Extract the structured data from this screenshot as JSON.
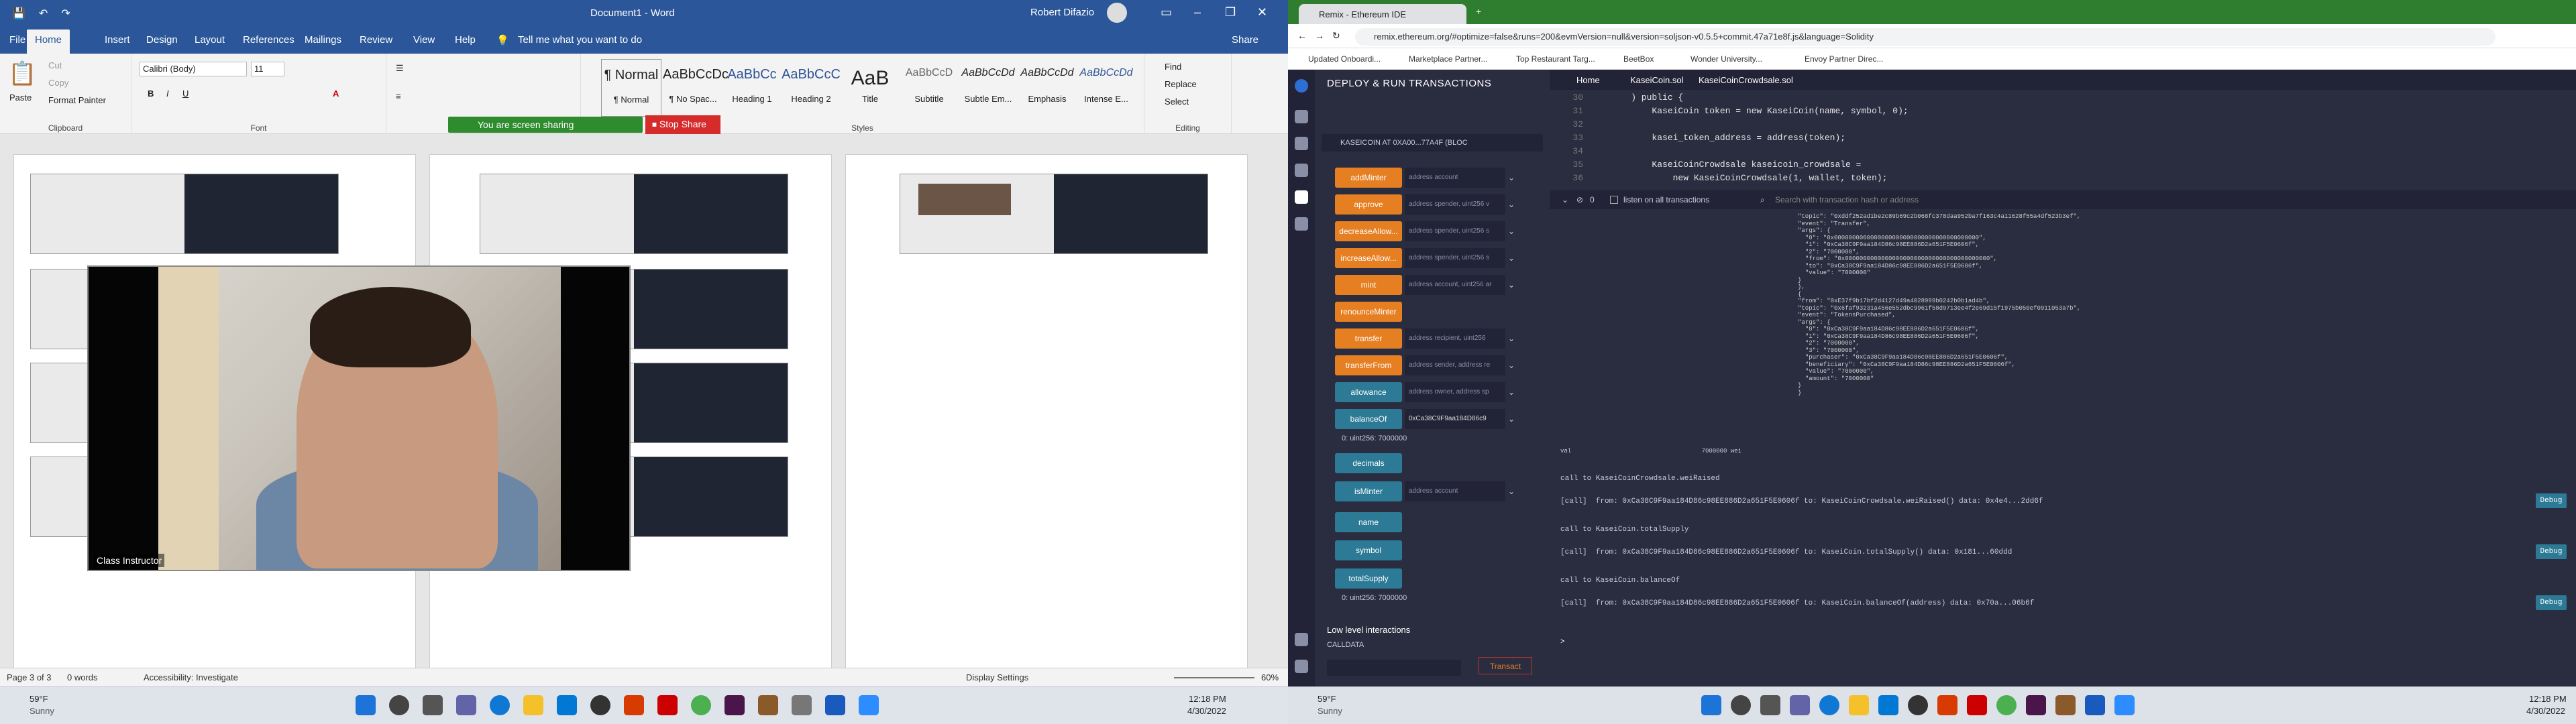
{
  "word": {
    "title": "Document1  -  Word",
    "user": "Robert Difazio",
    "share": "Share",
    "tabs": [
      "File",
      "Home",
      "Insert",
      "Design",
      "Layout",
      "References",
      "Mailings",
      "Review",
      "View",
      "Help"
    ],
    "tell_me": "Tell me what you want to do",
    "clipboard": {
      "paste": "Paste",
      "cut": "Cut",
      "copy": "Copy",
      "format_painter": "Format Painter",
      "label": "Clipboard"
    },
    "font": {
      "name": "Calibri (Body)",
      "size": "11",
      "label": "Font"
    },
    "paragraph_label": "Paragraph",
    "styles": [
      {
        "preview": "¶ Normal",
        "name": "¶ Normal"
      },
      {
        "preview": "AaBbCcDc",
        "name": "¶ No Spac..."
      },
      {
        "preview": "AaBbCc",
        "name": "Heading 1"
      },
      {
        "preview": "AaBbCcC",
        "name": "Heading 2"
      },
      {
        "preview": "AaB",
        "name": "Title"
      },
      {
        "preview": "AaBbCcD",
        "name": "Subtitle"
      },
      {
        "preview": "AaBbCcDd",
        "name": "Subtle Em..."
      },
      {
        "preview": "AaBbCcDd",
        "name": "Emphasis"
      },
      {
        "preview": "AaBbCcDd",
        "name": "Intense E..."
      }
    ],
    "styles_label": "Styles",
    "editing": {
      "find": "Find",
      "replace": "Replace",
      "select": "Select",
      "label": "Editing"
    },
    "screen_sharing": "You are screen sharing",
    "stop_share": "Stop Share",
    "video_label": "Class Instructor",
    "status": {
      "page": "Page 3 of 3",
      "words": "0 words",
      "accessibility": "Accessibility: Investigate",
      "display": "Display Settings",
      "zoom": "60%"
    }
  },
  "left_taskbar": {
    "temp": "59°F",
    "cond": "Sunny",
    "time": "12:18 PM",
    "date": "4/30/2022"
  },
  "chrome": {
    "tab_title": "Remix - Ethereum IDE",
    "url": "remix.ethereum.org/#optimize=false&runs=200&evmVersion=null&version=soljson-v0.5.5+commit.47a71e8f.js&language=Solidity",
    "bookmarks": [
      "Updated Onboardi...",
      "Marketplace Partner...",
      "Top Restaurant Targ...",
      "BeetBox",
      "Wonder University...",
      "Envoy Partner Direc..."
    ]
  },
  "remix": {
    "panel_title": "DEPLOY & RUN TRANSACTIONS",
    "instance": "KASEICOIN AT 0XA00...77A4F (BLOC",
    "functions": [
      {
        "name": "addMinter",
        "arg": "address account",
        "color": "orange"
      },
      {
        "name": "approve",
        "arg": "address spender, uint256 v",
        "color": "orange"
      },
      {
        "name": "decreaseAllow...",
        "arg": "address spender, uint256 s",
        "color": "orange"
      },
      {
        "name": "increaseAllow...",
        "arg": "address spender, uint256 s",
        "color": "orange"
      },
      {
        "name": "mint",
        "arg": "address account, uint256 ar",
        "color": "orange"
      },
      {
        "name": "renounceMinter",
        "arg": "",
        "color": "orange"
      },
      {
        "name": "transfer",
        "arg": "address recipient, uint256",
        "color": "orange"
      },
      {
        "name": "transferFrom",
        "arg": "address sender, address re",
        "color": "orange"
      },
      {
        "name": "allowance",
        "arg": "address owner, address sp",
        "color": "blue"
      },
      {
        "name": "balanceOf",
        "arg": "0xCa38C9F9aa184D86c9",
        "color": "blue"
      }
    ],
    "balance_result": "0: uint256: 7000000",
    "functions2": [
      {
        "name": "decimals",
        "arg": "",
        "color": "blue"
      },
      {
        "name": "isMinter",
        "arg": "address account",
        "color": "blue"
      },
      {
        "name": "name",
        "arg": "",
        "color": "blue"
      },
      {
        "name": "symbol",
        "arg": "",
        "color": "blue"
      },
      {
        "name": "totalSupply",
        "arg": "",
        "color": "blue"
      }
    ],
    "supply_result": "0: uint256: 7000000",
    "low_level": "Low level interactions",
    "calldata": "CALLDATA",
    "transact": "Transact",
    "editor_tabs": [
      "Home",
      "KaseiCoin.sol",
      "KaseiCoinCrowdsale.sol"
    ],
    "code": [
      {
        "n": "30",
        "t": "    ) public {"
      },
      {
        "n": "31",
        "t": "        KaseiCoin token = new KaseiCoin(name, symbol, 0);"
      },
      {
        "n": "32",
        "t": ""
      },
      {
        "n": "33",
        "t": "        kasei_token_address = address(token);"
      },
      {
        "n": "34",
        "t": ""
      },
      {
        "n": "35",
        "t": "        KaseiCoinCrowdsale kaseicoin_crowdsale ="
      },
      {
        "n": "36",
        "t": "            new KaseiCoinCrowdsale(1, wallet, token);"
      }
    ],
    "terminal_bar": {
      "count": "0",
      "listen": "listen on all transactions",
      "search": "Search with transaction hash or address"
    },
    "log_json": [
      "\"topic\": \"0xddf252ad1be2c89b69c2b068fc378daa952ba7f163c4a11628f55a4df523b3ef\",",
      "\"event\": \"Transfer\",",
      "\"args\": {",
      "  \"0\": \"0x0000000000000000000000000000000000000000\",",
      "  \"1\": \"0xCa38C9F9aa184D86c98EE886D2a651F5E0606f\",",
      "  \"2\": \"7000000\",",
      "  \"from\": \"0x0000000000000000000000000000000000000000\",",
      "  \"to\": \"0xCa38C9F9aa184D86c98EE886D2a651F5E0606f\",",
      "  \"value\": \"7000000\"",
      "}",
      "},",
      "{",
      "\"from\": \"0xE37f9b17bf2d4127d49a4028999b0242b0b1ad4b\",",
      "\"topic\": \"0x6faf93231a456e552dbc9961f58d9713ee4f2e69d15f1975b050ef0911053a7b\",",
      "\"event\": \"TokensPurchased\",",
      "\"args\": {",
      "  \"0\": \"0xCa38C9F9aa184D86c98EE886D2a651F5E0606f\",",
      "  \"1\": \"0xCa38C9F9aa184D86c98EE886D2a651F5E0606f\",",
      "  \"2\": \"7000000\",",
      "  \"3\": \"7000000\",",
      "  \"purchaser\": \"0xCa38C9F9aa184D86c98EE886D2a651F5E0606f\",",
      "  \"beneficiary\": \"0xCa38C9F9aa184D86c98EE886D2a651F5E0606f\",",
      "  \"value\": \"7000000\",",
      "  \"amount\": \"7000000\"",
      "}",
      "}"
    ],
    "val_line": "val                                    7000000 wei",
    "calls": [
      {
        "head": "call to KaseiCoinCrowdsale.weiRaised",
        "line": "[call]  from: 0xCa38C9F9aa184D86c98EE886D2a651F5E0606f to: KaseiCoinCrowdsale.weiRaised() data: 0x4e4...2dd6f"
      },
      {
        "head": "call to KaseiCoin.totalSupply",
        "line": "[call]  from: 0xCa38C9F9aa184D86c98EE886D2a651F5E0606f to: KaseiCoin.totalSupply() data: 0x181...60ddd"
      },
      {
        "head": "call to KaseiCoin.balanceOf",
        "line": "[call]  from: 0xCa38C9F9aa184D86c98EE886D2a651F5E0606f to: KaseiCoin.balanceOf(address) data: 0x70a...06b6f"
      }
    ],
    "debug": "Debug"
  },
  "right_taskbar": {
    "temp": "59°F",
    "cond": "Sunny",
    "time": "12:18 PM",
    "date": "4/30/2022"
  }
}
